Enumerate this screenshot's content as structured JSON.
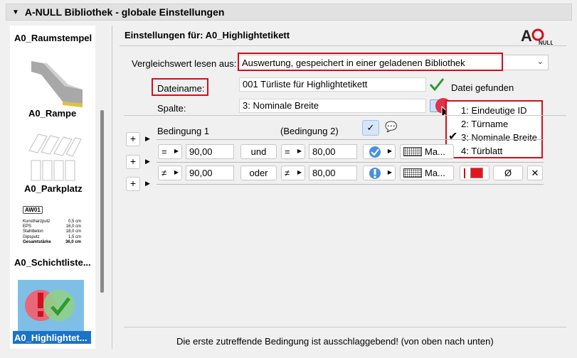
{
  "window": {
    "title": "A-NULL Bibliothek - globale Einstellungen"
  },
  "sidebar": {
    "items": [
      {
        "label": "A0_Raumstempel"
      },
      {
        "label": "A0_Rampe"
      },
      {
        "label": "A0_Parkplatz"
      },
      {
        "label": "A0_Schichtliste...",
        "thumb_badge": "AW01",
        "thumb_rows": [
          [
            "Kunstharzputz",
            "0,5 cm"
          ],
          [
            "EPS",
            "16,0 cm"
          ],
          [
            "Stahlbeton",
            "18,0 cm"
          ],
          [
            "Gipsputz",
            "1,5 cm"
          ],
          [
            "Gesamtstärke",
            "36,0 cm"
          ]
        ]
      },
      {
        "label": "A0_Highlightet...",
        "selected": true
      }
    ]
  },
  "header": {
    "title": "Einstellungen für: A0_Highlightetikett",
    "logo": "AONULL"
  },
  "form": {
    "compare_label": "Vergleichswert lesen aus:",
    "compare_value": "Auswertung, gespeichert in einer geladenen Bibliothek",
    "filename_label": "Dateiname:",
    "filename_value": "001 Türliste für Highlightetikett",
    "file_status": "Datei gefunden",
    "column_label": "Spalte:",
    "column_value": "3: Nominale Breite"
  },
  "dropdown": {
    "options": [
      "1: Eindeutige ID",
      "2: Türname",
      "3: Nominale Breite",
      "4: Türblatt"
    ],
    "selected": "3: Nominale Breite"
  },
  "conditions": {
    "header1": "Bedingung 1",
    "header2": "(Bedingung 2)",
    "rows": [
      {
        "op1": "=",
        "val1": "90,00",
        "join": "und",
        "op2": "=",
        "val2": "80,00",
        "pattern_label": "Ma..."
      },
      {
        "op1": "≠",
        "val1": "90,00",
        "join": "oder",
        "op2": "≠",
        "val2": "80,00",
        "pattern_label": "Ma...",
        "pen_color": "#e8141c",
        "empty_symbol": "Ø",
        "clear": "✕"
      }
    ]
  },
  "footer": {
    "text": "Die erste zutreffende Bedingung ist ausschlaggebend! (von oben nach unten)"
  },
  "colors": {
    "accent_red": "#d0101c",
    "check_green": "#2e9a2e",
    "check_blue": "#2a6fd6"
  }
}
